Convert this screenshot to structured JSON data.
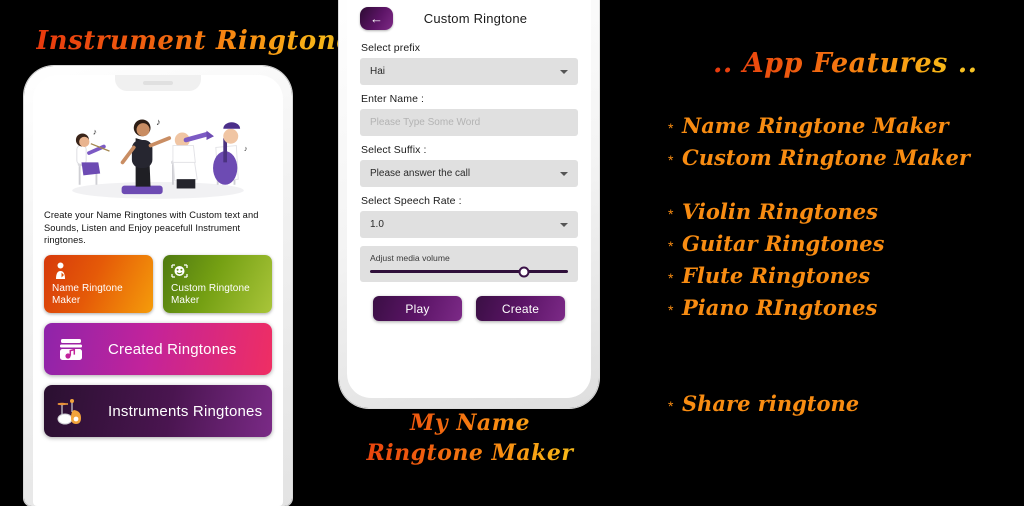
{
  "left_panel": {
    "headline": "Instrument Ringtones",
    "screen": {
      "description": "Create your Name Ringtones with Custom text and Sounds, Listen and Enjoy peacefull Instrument ringtones.",
      "tiles": [
        {
          "id": "name-ringtone-maker",
          "label": "Name Ringtone Maker",
          "icon": "bell-person-icon",
          "color": "#e55a08"
        },
        {
          "id": "custom-ringtone-maker",
          "label": "Custom Ringtone Maker",
          "icon": "face-smiley-icon",
          "color": "#75a013"
        },
        {
          "id": "created-ringtones",
          "label": "Created Ringtones",
          "icon": "music-box-icon",
          "color": "#ef2e63"
        },
        {
          "id": "instruments-ringtones",
          "label": "Instruments Ringtones",
          "icon": "drum-kit-icon",
          "color": "#7a2a86"
        }
      ],
      "illustration": "orchestra-band-illustration"
    }
  },
  "center_panel": {
    "appbar": {
      "back_icon": "arrow-left-icon",
      "title": "Custom Ringtone"
    },
    "form": {
      "prefix": {
        "label": "Select prefix",
        "value": "Hai",
        "caret_icon": "chevron-down-icon"
      },
      "name": {
        "label": "Enter Name :",
        "value": "",
        "placeholder": "Please Type Some Word"
      },
      "suffix": {
        "label": "Select Suffix :",
        "value": "Please answer the call",
        "caret_icon": "chevron-down-icon"
      },
      "speech_rate": {
        "label": "Select Speech Rate :",
        "value": "1.0",
        "caret_icon": "chevron-down-icon"
      },
      "volume": {
        "label": "Adjust media volume",
        "percent": 78
      },
      "buttons": {
        "play": "Play",
        "create": "Create"
      }
    },
    "caption_line1": "My Name",
    "caption_line2": "Ringtone Maker"
  },
  "right_panel": {
    "title": ".. App Features ..",
    "bullet": "*",
    "features_group1": [
      "Name Ringtone Maker",
      "Custom Ringtone Maker"
    ],
    "features_group2": [
      "Violin Ringtones",
      "Guitar Ringtones",
      "Flute Ringtones",
      "Piano RIngtones"
    ],
    "features_group3": [
      "Share ringtone"
    ]
  },
  "theme": {
    "background": "#000000",
    "accent_orange": "#f88c12",
    "accent_red": "#e8380d",
    "accent_yellow": "#f6c62a",
    "purple": "#5b1466",
    "pink": "#ef2e63"
  }
}
